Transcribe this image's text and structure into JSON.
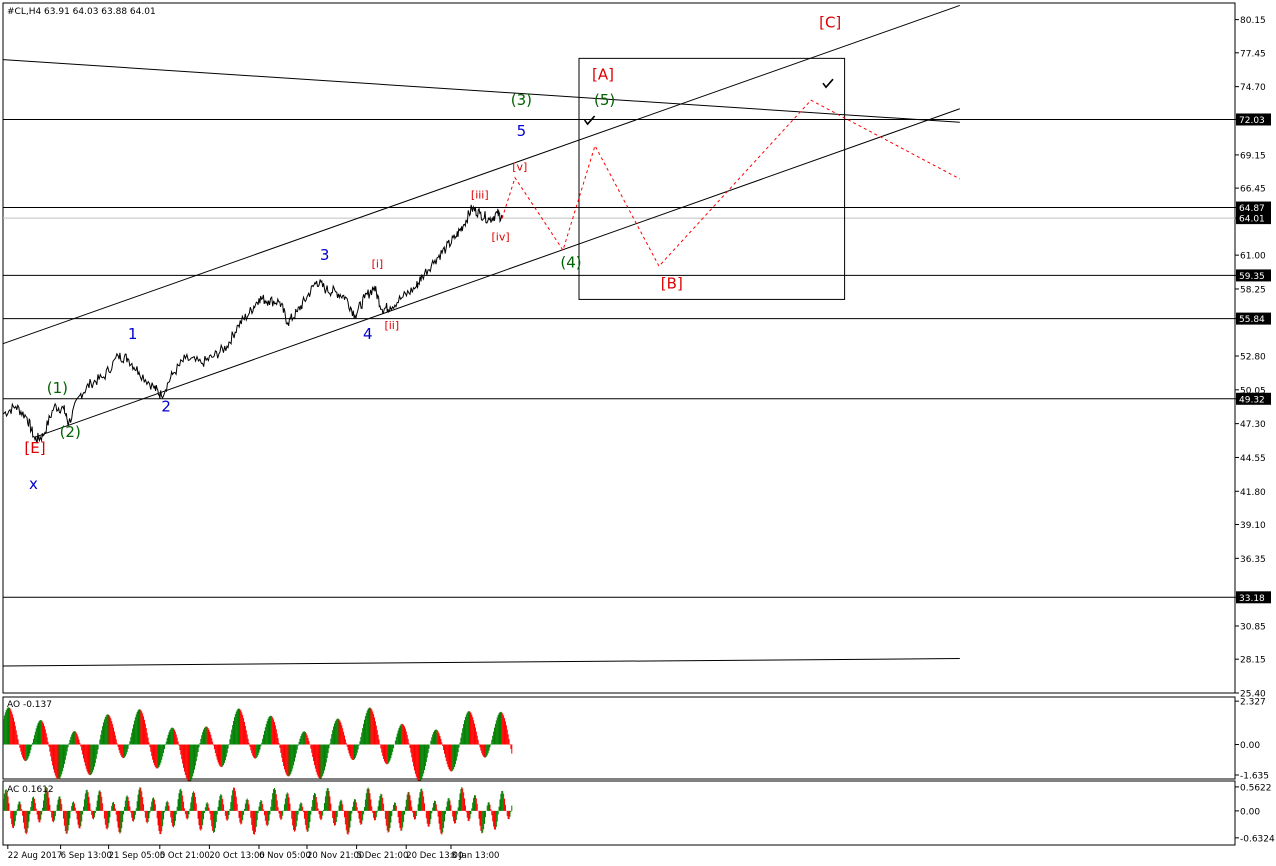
{
  "chart_data": {
    "type": "line",
    "header": "#CL,H4   63.91 64.03 63.88 64.01",
    "price_axis": {
      "range": [
        25.4,
        81.5
      ],
      "ticks": [
        "80.15",
        "77.45",
        "74.70",
        "72.03",
        "69.15",
        "66.45",
        "64.87",
        "64.01",
        "61.00",
        "59.35",
        "58.25",
        "55.84",
        "52.80",
        "50.05",
        "49.32",
        "47.30",
        "44.55",
        "41.80",
        "39.10",
        "36.35",
        "33.18",
        "30.85",
        "28.15",
        "25.40"
      ],
      "highlighted": [
        "72.03",
        "64.87",
        "64.01",
        "59.35",
        "55.84",
        "49.32",
        "33.18"
      ]
    },
    "time_axis": {
      "range": [
        0,
        36
      ],
      "labels": [
        "22 Aug 2017",
        "6 Sep 13:00",
        "21 Sep 05:00",
        "5 Oct 21:00",
        "20 Oct 13:00",
        "6 Nov 05:00",
        "20 Nov 21:00",
        "5 Dec 21:00",
        "20 Dec 13:00",
        "8 Jan 13:00"
      ],
      "label_x": [
        0.3,
        3.6,
        6.6,
        9.8,
        12.9,
        16.0,
        19.0,
        22.1,
        25.2,
        28.0
      ]
    },
    "price_keypoints": [
      [
        0.0,
        48.1
      ],
      [
        0.8,
        48.7
      ],
      [
        1.5,
        47.8
      ],
      [
        2.0,
        46.0
      ],
      [
        2.5,
        46.3
      ],
      [
        3.2,
        48.7
      ],
      [
        3.8,
        48.5
      ],
      [
        4.1,
        47.3
      ],
      [
        4.8,
        49.6
      ],
      [
        5.5,
        50.6
      ],
      [
        6.3,
        51.1
      ],
      [
        7.2,
        52.8
      ],
      [
        7.8,
        52.6
      ],
      [
        8.5,
        51.5
      ],
      [
        9.4,
        50.3
      ],
      [
        9.9,
        49.6
      ],
      [
        10.6,
        51.3
      ],
      [
        11.4,
        52.6
      ],
      [
        12.4,
        52.2
      ],
      [
        13.2,
        52.8
      ],
      [
        14.0,
        53.6
      ],
      [
        14.7,
        55.3
      ],
      [
        15.4,
        56.3
      ],
      [
        16.0,
        57.5
      ],
      [
        16.6,
        57.3
      ],
      [
        17.3,
        57.2
      ],
      [
        17.8,
        55.5
      ],
      [
        18.4,
        56.4
      ],
      [
        19.0,
        57.6
      ],
      [
        19.6,
        58.9
      ],
      [
        20.2,
        58.2
      ],
      [
        20.8,
        58.0
      ],
      [
        21.4,
        57.6
      ],
      [
        22.0,
        56.1
      ],
      [
        22.6,
        57.5
      ],
      [
        23.2,
        58.4
      ],
      [
        23.7,
        56.6
      ],
      [
        24.2,
        56.8
      ],
      [
        25.0,
        57.6
      ],
      [
        25.8,
        58.4
      ],
      [
        26.2,
        59.3
      ],
      [
        27.0,
        60.6
      ],
      [
        27.7,
        61.6
      ],
      [
        28.3,
        62.5
      ],
      [
        28.8,
        63.5
      ],
      [
        29.3,
        64.8
      ],
      [
        29.8,
        64.4
      ],
      [
        30.4,
        63.9
      ],
      [
        30.9,
        64.4
      ],
      [
        31.2,
        64.0
      ]
    ],
    "forecast_path": [
      [
        31.2,
        64.0
      ],
      [
        32.0,
        67.3
      ],
      [
        35.0,
        61.4
      ],
      [
        37.0,
        69.9
      ],
      [
        41.0,
        60.1
      ],
      [
        50.5,
        73.6
      ],
      [
        59.8,
        67.2
      ]
    ],
    "horizontal_levels": [
      {
        "price": 72.03,
        "label": "72.03"
      },
      {
        "price": 64.87,
        "label": "64.87"
      },
      {
        "price": 59.35,
        "label": "59.35"
      },
      {
        "price": 55.84,
        "label": "55.84"
      },
      {
        "price": 49.32,
        "label": "49.32"
      },
      {
        "price": 33.18,
        "label": "33.18"
      }
    ],
    "current_price": {
      "price": 64.01,
      "label": "64.01"
    },
    "trend_lines": [
      [
        [
          0.0,
          76.9
        ],
        [
          59.8,
          71.8
        ]
      ],
      [
        [
          0.0,
          53.8
        ],
        [
          59.8,
          81.3
        ]
      ],
      [
        [
          2.0,
          46.2
        ],
        [
          59.8,
          72.9
        ]
      ],
      [
        [
          0.0,
          27.6
        ],
        [
          59.8,
          28.2
        ]
      ]
    ],
    "forecast_box": {
      "x": [
        36.0,
        52.6
      ],
      "price": [
        57.4,
        77.0
      ]
    },
    "wave_labels": [
      {
        "text": "[E]",
        "x": 2.0,
        "price": 44.9,
        "color": "red"
      },
      {
        "text": "x",
        "x": 1.9,
        "price": 42.0,
        "color": "blue"
      },
      {
        "text": "(1)",
        "x": 3.4,
        "price": 49.8,
        "color": "green"
      },
      {
        "text": "(2)",
        "x": 4.2,
        "price": 46.2,
        "color": "green"
      },
      {
        "text": "1",
        "x": 8.1,
        "price": 54.2,
        "color": "blue"
      },
      {
        "text": "2",
        "x": 10.2,
        "price": 48.3,
        "color": "blue"
      },
      {
        "text": "3",
        "x": 20.1,
        "price": 60.6,
        "color": "blue"
      },
      {
        "text": "4",
        "x": 22.8,
        "price": 54.2,
        "color": "blue"
      },
      {
        "text": "[i]",
        "x": 23.4,
        "price": 60.0,
        "color": "red"
      },
      {
        "text": "[ii]",
        "x": 24.3,
        "price": 55.0,
        "color": "red"
      },
      {
        "text": "[iii]",
        "x": 29.8,
        "price": 65.6,
        "color": "red"
      },
      {
        "text": "[iv]",
        "x": 31.1,
        "price": 62.2,
        "color": "red"
      },
      {
        "text": "[v]",
        "x": 32.3,
        "price": 67.9,
        "color": "red"
      },
      {
        "text": "(3)",
        "x": 32.4,
        "price": 73.2,
        "color": "green"
      },
      {
        "text": "5",
        "x": 32.4,
        "price": 70.7,
        "color": "blue"
      },
      {
        "text": "(4)",
        "x": 35.5,
        "price": 60.0,
        "color": "green"
      },
      {
        "text": "(5)",
        "x": 37.6,
        "price": 73.2,
        "color": "green"
      },
      {
        "text": "[A]",
        "x": 37.5,
        "price": 75.3,
        "color": "red"
      },
      {
        "text": "[B]",
        "x": 41.8,
        "price": 58.3,
        "color": "red"
      },
      {
        "text": "[C]",
        "x": 51.7,
        "price": 79.5,
        "color": "red"
      }
    ],
    "checkmarks": [
      [
        36.6,
        71.9
      ],
      [
        51.5,
        74.9
      ]
    ],
    "ao": {
      "label": "AO -0.137",
      "range": [
        -1.85,
        2.55
      ],
      "ticks": [
        "2.327",
        "0.00",
        "-1.635"
      ]
    },
    "ac": {
      "label": "AC 0.1612",
      "range": [
        -0.8,
        0.7
      ],
      "ticks": [
        "0.5622",
        "0.00",
        "-0.6324"
      ]
    },
    "colors": {
      "up_bar": "#008000",
      "down_bar": "#ff0000",
      "red_label": "#dd0000",
      "blue_label": "#0000cc",
      "green_label": "#006400",
      "forecast": "#ff0000"
    }
  }
}
